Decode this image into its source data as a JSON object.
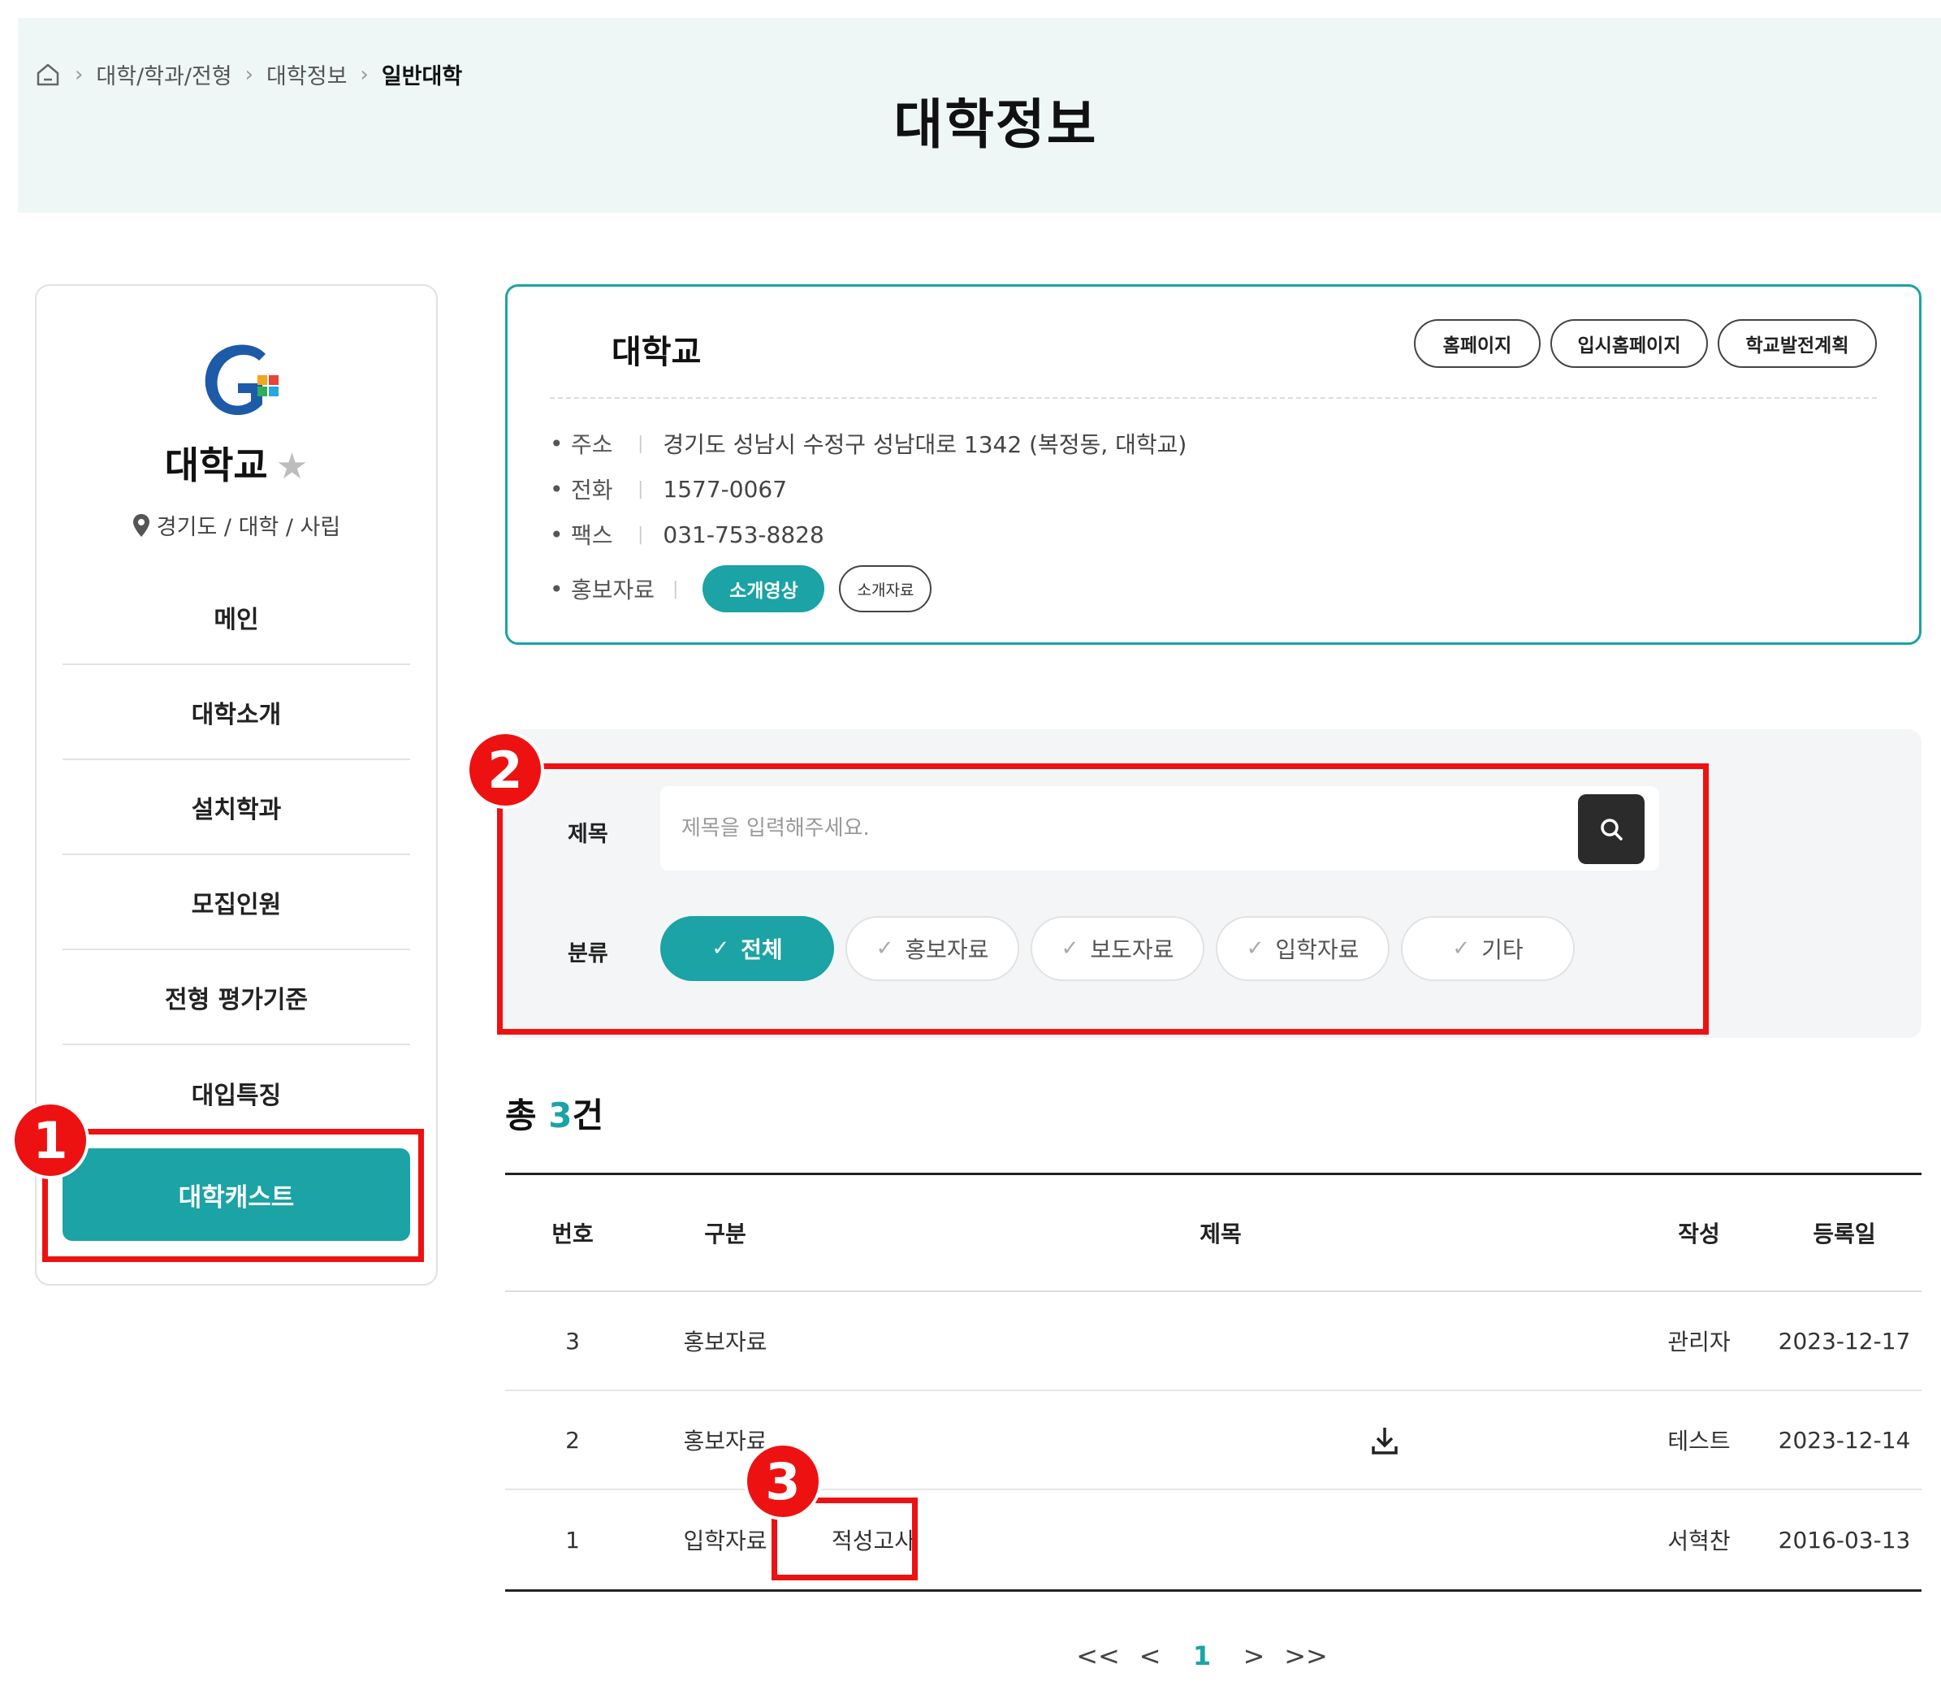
{
  "breadcrumb": {
    "items": [
      "대학/학과/전형",
      "대학정보"
    ],
    "current": "일반대학"
  },
  "page_title": "대학정보",
  "sidebar": {
    "school_name": "대학교",
    "location": "경기도 / 대학 / 사립",
    "menu": [
      "메인",
      "대학소개",
      "설치학과",
      "모집인원",
      "전형 평가기준",
      "대입특징"
    ],
    "active": "대학캐스트"
  },
  "info": {
    "title": "대학교",
    "buttons": [
      "홈페이지",
      "입시홈페이지",
      "학교발전계획"
    ],
    "rows": [
      {
        "label": "주소",
        "value": "경기도 성남시 수정구 성남대로 1342 (복정동,      대학교)"
      },
      {
        "label": "전화",
        "value": "1577-0067"
      },
      {
        "label": "팩스",
        "value": "031-753-8828"
      }
    ],
    "promo_label": "홍보자료",
    "promo_buttons": [
      "소개영상",
      "소개자료"
    ]
  },
  "search": {
    "title_label": "제목",
    "placeholder": "제목을 입력해주세요.",
    "category_label": "분류",
    "filters": [
      "전체",
      "홍보자료",
      "보도자료",
      "입학자료",
      "기타"
    ],
    "active_filter": "전체"
  },
  "count": {
    "prefix": "총 ",
    "number": "3",
    "suffix": "건"
  },
  "table": {
    "headers": [
      "번호",
      "구분",
      "제목",
      "작성",
      "등록일"
    ],
    "rows": [
      {
        "no": "3",
        "category": "홍보자료",
        "title": "",
        "author": "관리자",
        "date": "2023-12-17"
      },
      {
        "no": "2",
        "category": "홍보자료",
        "title": "",
        "author": "테스트",
        "date": "2023-12-14"
      },
      {
        "no": "1",
        "category": "입학자료",
        "title": "적성고사",
        "author": "서혁찬",
        "date": "2016-03-13"
      }
    ]
  },
  "pagination": {
    "first": "<<",
    "prev": "<",
    "current": "1",
    "next": ">",
    "last": ">>"
  },
  "annotations": [
    "1",
    "2",
    "3"
  ],
  "colors": {
    "accent": "#1ba3a5",
    "highlight": "#ee1111",
    "hero_bg": "#eef6f6"
  }
}
